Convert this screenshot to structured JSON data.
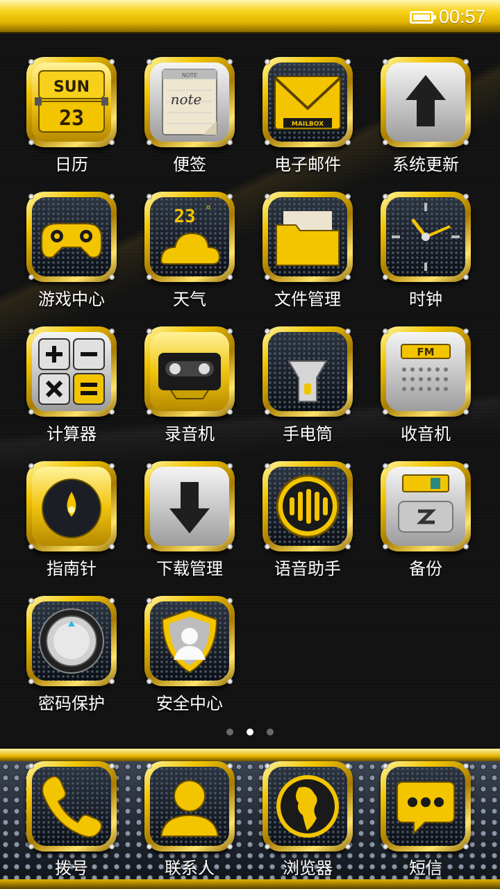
{
  "status_bar": {
    "time": "00:57",
    "battery_icon": "battery-full-icon"
  },
  "apps": [
    {
      "label": "日历",
      "icon": "calendar-icon",
      "calendar_day": "SUN",
      "calendar_date": "23"
    },
    {
      "label": "便签",
      "icon": "note-icon",
      "note_text": "note",
      "note_header": "NOTE"
    },
    {
      "label": "电子邮件",
      "icon": "mailbox-icon",
      "mail_text": "MAILBOX"
    },
    {
      "label": "系统更新",
      "icon": "update-arrow-icon"
    },
    {
      "label": "游戏中心",
      "icon": "gamepad-icon"
    },
    {
      "label": "天气",
      "icon": "weather-cloud-icon",
      "temperature": "23",
      "degree": "°"
    },
    {
      "label": "文件管理",
      "icon": "folder-icon"
    },
    {
      "label": "时钟",
      "icon": "clock-icon"
    },
    {
      "label": "计算器",
      "icon": "calculator-icon"
    },
    {
      "label": "录音机",
      "icon": "cassette-icon"
    },
    {
      "label": "手电筒",
      "icon": "flashlight-icon"
    },
    {
      "label": "收音机",
      "icon": "radio-icon",
      "radio_band": "FM"
    },
    {
      "label": "指南针",
      "icon": "compass-icon"
    },
    {
      "label": "下载管理",
      "icon": "download-arrow-icon"
    },
    {
      "label": "语音助手",
      "icon": "voice-assistant-icon"
    },
    {
      "label": "备份",
      "icon": "backup-icon"
    },
    {
      "label": "密码保护",
      "icon": "password-dial-icon"
    },
    {
      "label": "安全中心",
      "icon": "security-shield-icon"
    }
  ],
  "page_indicator": {
    "count": 3,
    "active_index": 1
  },
  "dock": [
    {
      "label": "拨号",
      "icon": "phone-icon"
    },
    {
      "label": "联系人",
      "icon": "contact-person-icon"
    },
    {
      "label": "浏览器",
      "icon": "globe-icon"
    },
    {
      "label": "短信",
      "icon": "message-bubble-icon"
    }
  ],
  "colors": {
    "gold": "#f2c500",
    "dark": "#0d0d0d",
    "accent_text": "#ffffff"
  }
}
